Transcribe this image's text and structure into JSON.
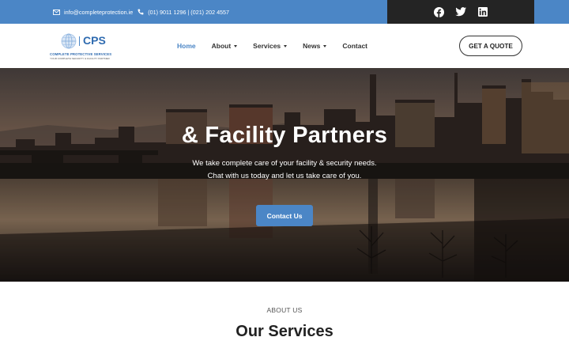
{
  "topbar": {
    "email": "info@completeprotection.ie",
    "phones": "(01) 9011 1296 | (021) 202 4557",
    "social": [
      "facebook-icon",
      "twitter-icon",
      "linkedin-icon"
    ]
  },
  "logo": {
    "abbr": "CPS",
    "name": "COMPLETE PROTECTIVE SERVICES",
    "tagline": "YOUR COMPLETE SECURITY & FACILITY PARTNER"
  },
  "nav": {
    "items": [
      {
        "label": "Home",
        "active": true
      },
      {
        "label": "About",
        "dropdown": true
      },
      {
        "label": "Services",
        "dropdown": true
      },
      {
        "label": "News",
        "dropdown": true
      },
      {
        "label": "Contact"
      }
    ]
  },
  "header": {
    "quote_label": "GET A QUOTE"
  },
  "hero": {
    "title": "& Facility Partners",
    "subtitle_line1": "We take complete care of your facility & security needs.",
    "subtitle_line2": "Chat with us today and let us take care of you.",
    "cta_label": "Contact Us"
  },
  "about": {
    "label": "ABOUT US",
    "heading": "Our Services"
  },
  "colors": {
    "accent": "#4b86c6",
    "topbar": "#4b86c6",
    "social_bg": "#242424"
  }
}
